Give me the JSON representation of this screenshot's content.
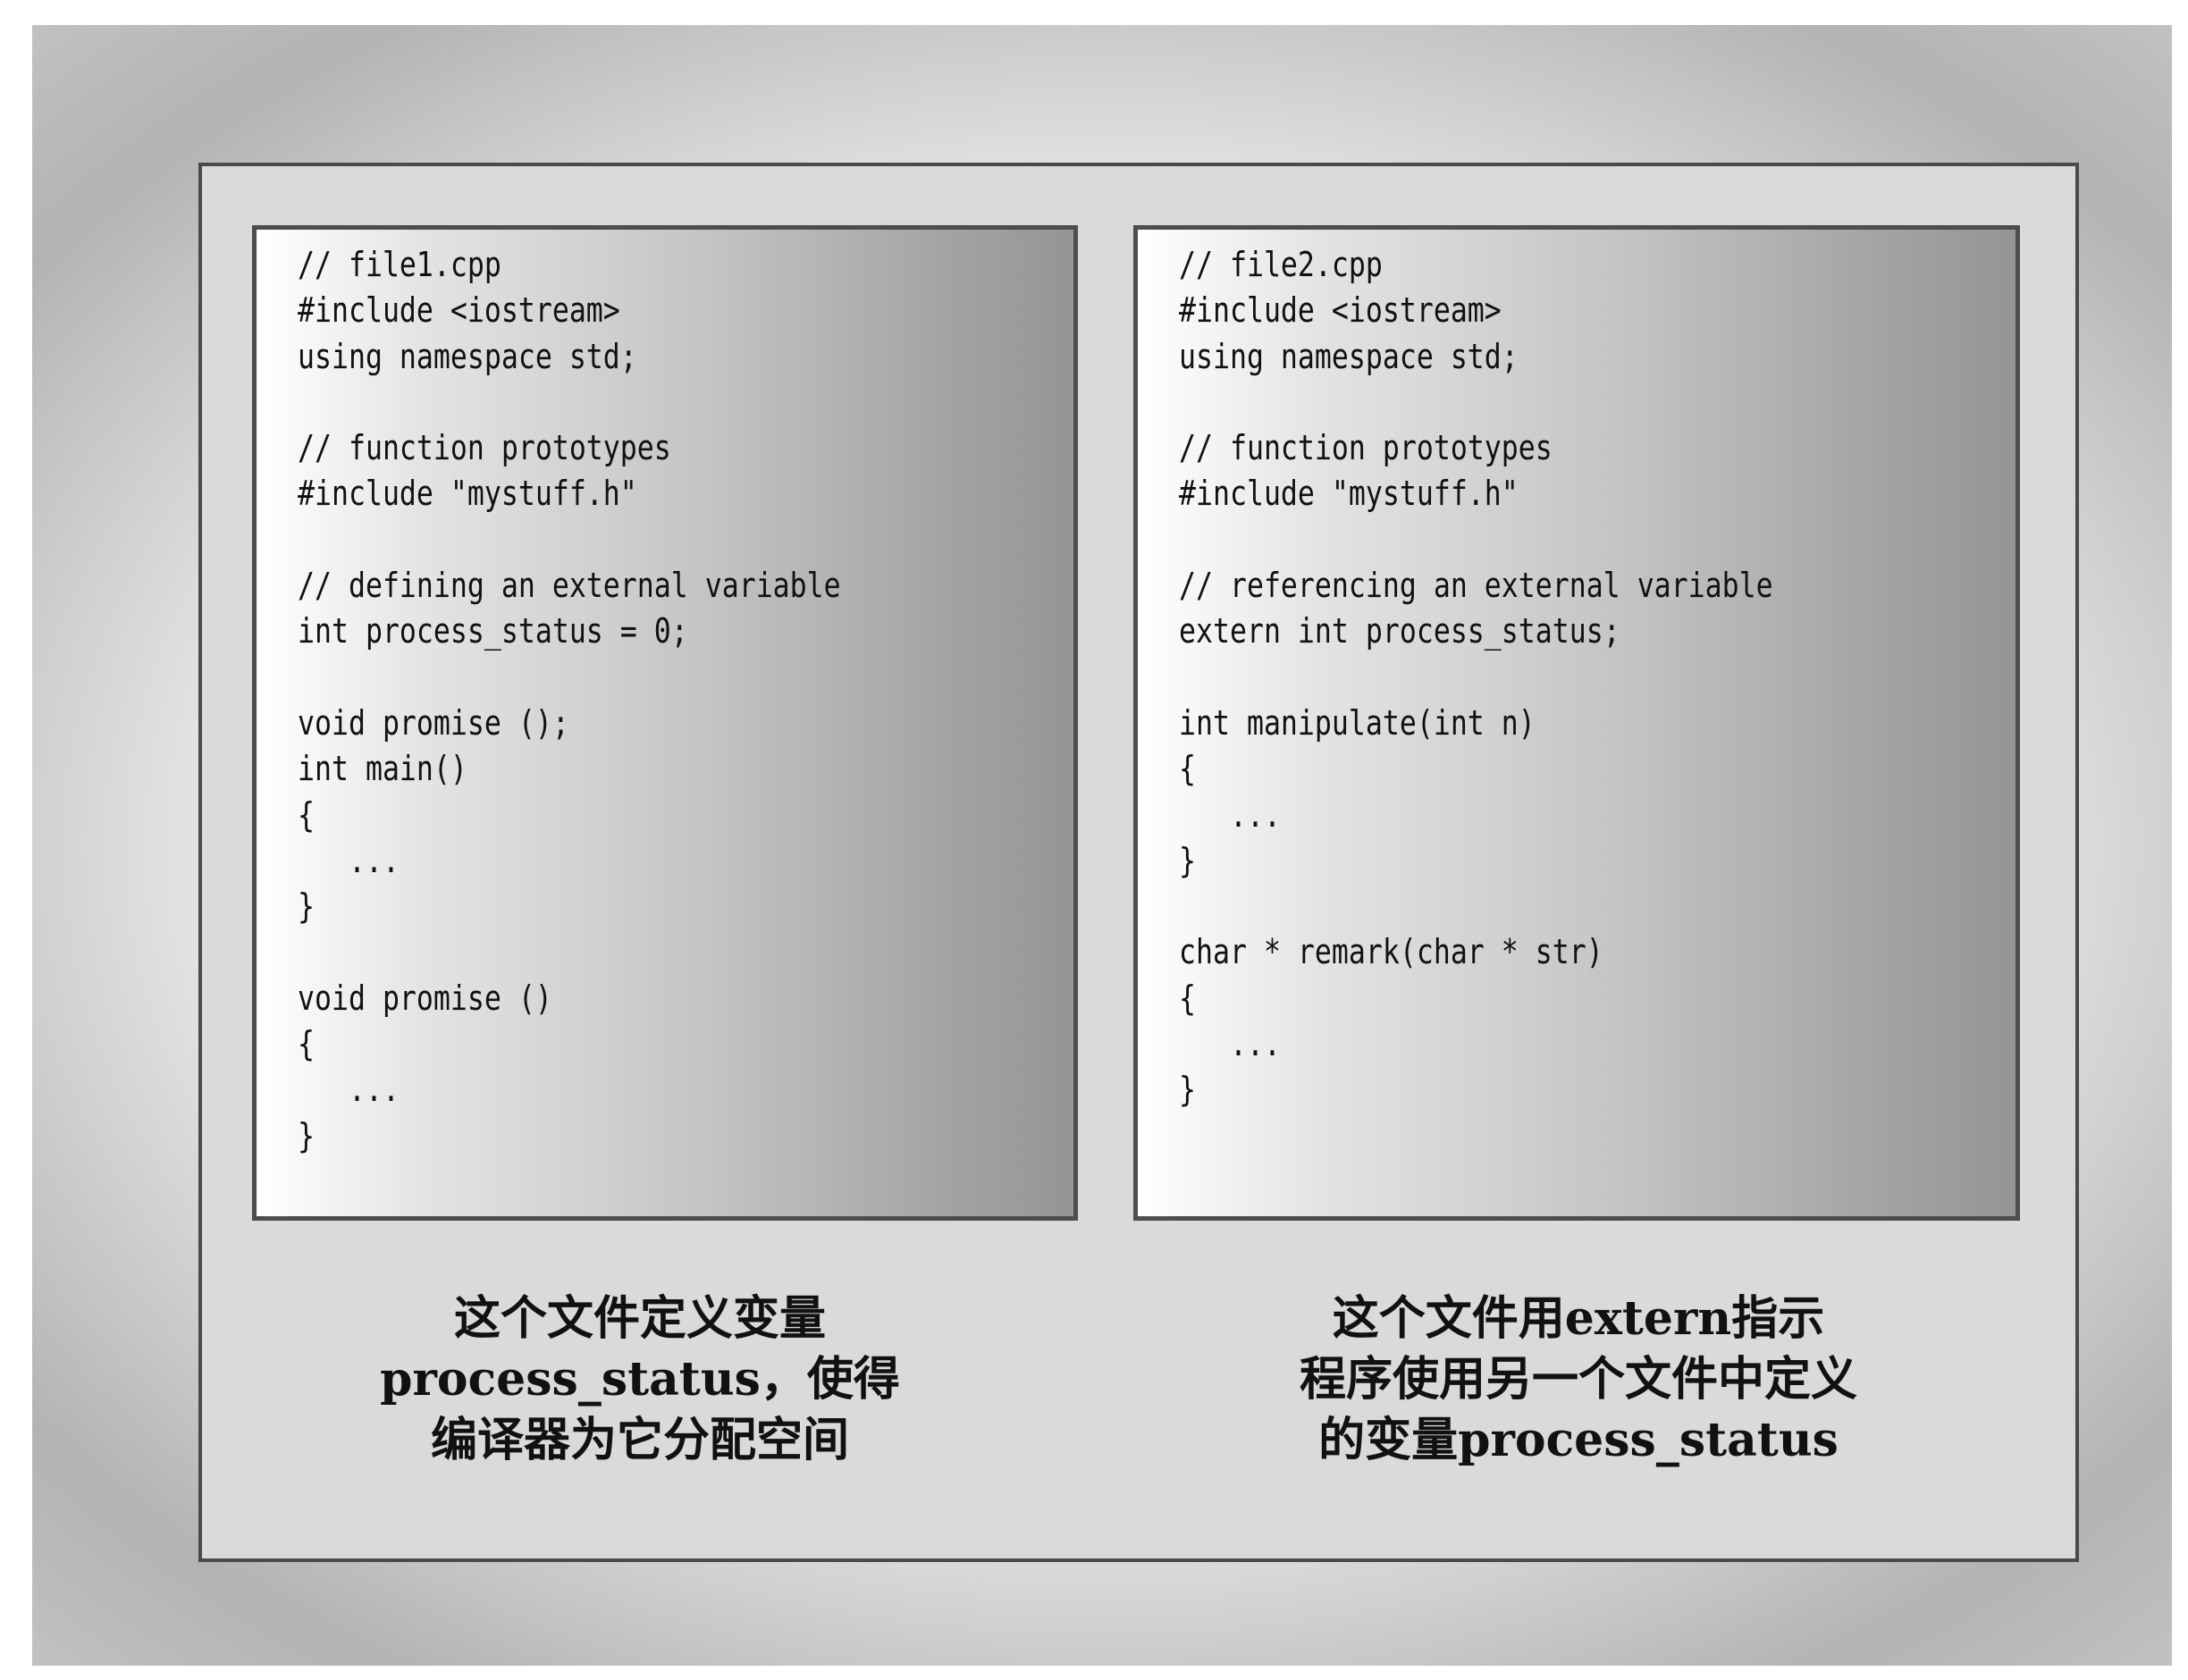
{
  "file1": {
    "code": "// file1.cpp\n#include <iostream>\nusing namespace std;\n\n// function prototypes\n#include \"mystuff.h\"\n\n// defining an external variable\nint process_status = 0;\n\nvoid promise ();\nint main()\n{\n   ...\n}\n\nvoid promise ()\n{\n   ...\n}",
    "caption": "这个文件定义变量\nprocess_status，使得\n编译器为它分配空间"
  },
  "file2": {
    "code": "// file2.cpp\n#include <iostream>\nusing namespace std;\n\n// function prototypes\n#include \"mystuff.h\"\n\n// referencing an external variable\nextern int process_status;\n\nint manipulate(int n)\n{\n   ...\n}\n\nchar * remark(char * str)\n{\n   ...\n}",
    "caption": "这个文件用extern指示\n程序使用另一个文件中定义\n的变量process_status"
  }
}
